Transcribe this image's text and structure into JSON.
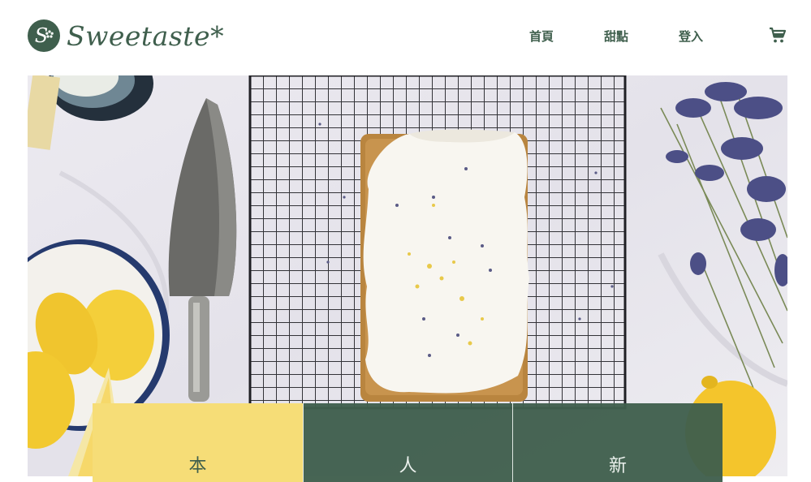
{
  "brand": {
    "name": "Sweetaste*",
    "mark_letter": "S",
    "color": "#3f5f4d"
  },
  "nav": {
    "items": [
      "首頁",
      "甜點",
      "登入"
    ],
    "cart_icon": "shopping-cart-icon"
  },
  "hero": {
    "image": "lemon-lavender-pound-cake-on-cooling-rack"
  },
  "features": [
    {
      "label": "本",
      "color": "#f6dd77"
    },
    {
      "label": "人",
      "color": "#3f5f4d"
    },
    {
      "label": "新",
      "color": "#3f5f4d"
    }
  ]
}
